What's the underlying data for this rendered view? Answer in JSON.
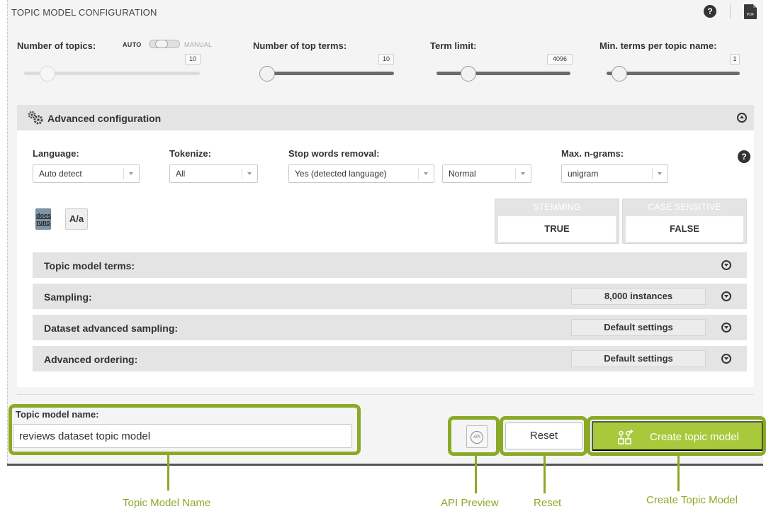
{
  "header": {
    "title": "TOPIC MODEL CONFIGURATION",
    "help_glyph": "?",
    "pdf_label": "PDF",
    "icons": [
      "help-icon",
      "pdf-icon"
    ]
  },
  "sliders": {
    "num_topics": {
      "label": "Number of topics:",
      "mode_auto": "AUTO",
      "mode_manual": "MANUAL",
      "mode_selected": "AUTO",
      "value": "10"
    },
    "top_terms": {
      "label": "Number of top terms:",
      "value": "10"
    },
    "term_limit": {
      "label": "Term limit:",
      "value": "4096"
    },
    "min_terms": {
      "label": "Min. terms per topic name:",
      "value": "1"
    }
  },
  "advanced": {
    "title": "Advanced configuration",
    "icons": [
      "gears-icon",
      "collapse-up-icon",
      "help-icon"
    ],
    "language": {
      "label": "Language:",
      "value": "Auto detect"
    },
    "tokenize": {
      "label": "Tokenize:",
      "value": "All"
    },
    "stop_words": {
      "label": "Stop words removal:",
      "value": "Yes (detected language)",
      "level": "Normal"
    },
    "ngrams": {
      "label": "Max. n-grams:",
      "value": "unigram"
    },
    "help_glyph": "?",
    "stemming_button": {
      "top": "does",
      "bottom": "runs"
    },
    "case_button": "A/a",
    "stemming": {
      "label": "STEMMING",
      "value": "TRUE"
    },
    "case_sensitive": {
      "label": "CASE SENSITIVE",
      "value": "FALSE"
    },
    "sections": [
      {
        "label": "Topic model terms:",
        "value": ""
      },
      {
        "label": "Sampling:",
        "value": "8,000 instances"
      },
      {
        "label": "Dataset advanced sampling:",
        "value": "Default settings"
      },
      {
        "label": "Advanced ordering:",
        "value": "Default settings"
      }
    ]
  },
  "footer": {
    "name_label": "Topic model name:",
    "name_value": "reviews dataset topic model",
    "api_label": "API",
    "reset_label": "Reset",
    "create_label": "Create topic model",
    "icons": [
      "api-icon",
      "create-model-icon"
    ]
  },
  "callouts": {
    "name": "Topic Model Name",
    "api": "API Preview",
    "reset": "Reset",
    "create": "Create Topic Model"
  },
  "colors": {
    "accent": "#a8c93b",
    "highlight": "#8aaa27",
    "header_bg": "#e4e4e4"
  }
}
